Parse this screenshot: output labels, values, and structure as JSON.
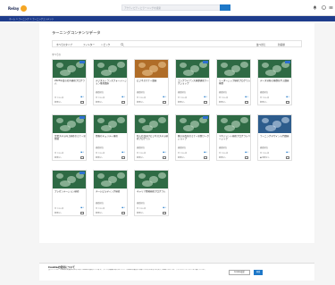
{
  "header": {
    "brand": "Relay",
    "search_placeholder": "アクティビティとラーニングを検索",
    "breadcrumb": "ホーム  >  ラーニング  >  ラーニングコンテンツ"
  },
  "main": {
    "title": "ラーニングコンテンツデータ",
    "filters": {
      "type": "すべてのタイプ",
      "category": "フィルター",
      "topic": "トピック",
      "sort_label": "並べ替え",
      "sort_value": "新着順"
    },
    "section_label": "すべての"
  },
  "cards": [
    {
      "title": "2023年度の社内研修プログラム",
      "author": "",
      "meta": "全 7/10 名",
      "stat": "● 0",
      "due": "期限なし",
      "thumb": "green",
      "tag": true
    },
    {
      "title": "デジタルトランスフォーメーション推進講座",
      "author": "研修担当",
      "meta": "全 7/10 名",
      "stat": "● 0",
      "due": "期限なし",
      "thumb": "green",
      "tag": false
    },
    {
      "title": "ビジネスマナー講座",
      "author": "研修担当",
      "meta": "全 7/10 名",
      "stat": "● 0",
      "due": "期限なし",
      "thumb": "orange",
      "tag": false
    },
    {
      "title": "コンプライアンス基礎研修ワークショップ",
      "author": "研修担当",
      "meta": "全 7/10 名",
      "stat": "● 0",
      "due": "期限なし",
      "thumb": "green",
      "tag": true
    },
    {
      "title": "リーダーシップ研修プログラム基礎",
      "author": "研修担当",
      "meta": "全 7/10 名",
      "stat": "● 0",
      "due": "期限なし",
      "thumb": "green",
      "tag": false
    },
    {
      "title": "データ分析の基礎を学ぶ講座",
      "author": "研修担当",
      "meta": "全 7/10 名",
      "stat": "● 0",
      "due": "期限なし",
      "thumb": "green",
      "tag": true
    },
    {
      "title": "営業スキル向上研修セミナー実践編",
      "author": "",
      "meta": "全 7/10 名",
      "stat": "● 0",
      "due": "期限なし",
      "thumb": "green",
      "tag": true
    },
    {
      "title": "情報セキュリティ研修",
      "author": "研修担当",
      "meta": "全 7/10 名",
      "stat": "● 0",
      "due": "期限なし",
      "thumb": "green",
      "tag": false
    },
    {
      "title": "新入社員向けビジネススキル研修プログラム",
      "author": "研修担当",
      "meta": "全 7/10 名",
      "stat": "● 0",
      "due": "期限なし",
      "thumb": "green",
      "tag": false
    },
    {
      "title": "働き方改革セミナー実践ワークショップ",
      "author": "研修担当",
      "meta": "全 7/10 名",
      "stat": "● 0",
      "due": "期限なし",
      "thumb": "green",
      "tag": true
    },
    {
      "title": "マネジメント研修プログラムベーシック",
      "author": "研修担当",
      "meta": "全 7/10 名",
      "stat": "● 0",
      "due": "期限なし",
      "thumb": "green",
      "tag": false
    },
    {
      "title": "ラーニングデザイン入門講座",
      "author": "研修担当",
      "meta": "全 7/10 名",
      "stat": "● 0",
      "due": "● 期限なし",
      "thumb": "blue",
      "tag": false
    },
    {
      "title": "プレゼンテーション研修",
      "author": "",
      "meta": "全 7/10 名",
      "stat": "● 0",
      "due": "期限なし",
      "thumb": "green",
      "tag": true
    },
    {
      "title": "チームビルディング研修",
      "author": "研修担当",
      "meta": "全 7/10 名",
      "stat": "● 0",
      "due": "期限なし",
      "thumb": "green",
      "tag": false
    },
    {
      "title": "キャリア開発研修プログラム",
      "author": "研修担当",
      "meta": "全 7/10 名",
      "stat": "● 0",
      "due": "期限なし",
      "thumb": "green",
      "tag": false
    }
  ],
  "cookie": {
    "title": "Cookieの使用について",
    "text": "当サイトでは、お客様の利便性向上のためにCookieを使用しています。サイトの閲覧を続けることで、Cookieの使用に同意したものとみなされます。詳細については、プライバシーポリシーをご覧ください。",
    "settings_label": "Cookie設定",
    "accept_label": "同意"
  }
}
